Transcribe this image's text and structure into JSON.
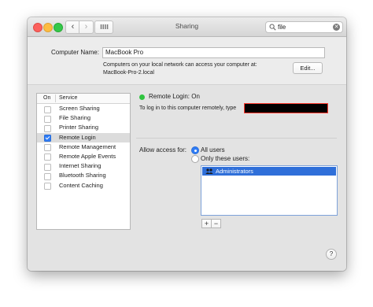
{
  "window": {
    "title": "Sharing",
    "search_value": "file"
  },
  "computer": {
    "label": "Computer Name:",
    "name_value": "MacBook Pro",
    "description_line1": "Computers on your local network can access your computer at:",
    "description_line2": "MacBook-Pro-2.local",
    "edit_label": "Edit..."
  },
  "services": {
    "col_on": "On",
    "col_service": "Service",
    "items": [
      {
        "label": "Screen Sharing",
        "checked": false
      },
      {
        "label": "File Sharing",
        "checked": false
      },
      {
        "label": "Printer Sharing",
        "checked": false
      },
      {
        "label": "Remote Login",
        "checked": true
      },
      {
        "label": "Remote Management",
        "checked": false
      },
      {
        "label": "Remote Apple Events",
        "checked": false
      },
      {
        "label": "Internet Sharing",
        "checked": false
      },
      {
        "label": "Bluetooth Sharing",
        "checked": false
      },
      {
        "label": "Content Caching",
        "checked": false
      }
    ]
  },
  "detail": {
    "status": "Remote Login: On",
    "login_instruction": "To log in to this computer remotely, type",
    "allow_access_label": "Allow access for:",
    "option_all": "All users",
    "option_only": "Only these users:",
    "users": [
      "Administrators"
    ]
  },
  "buttons": {
    "plus": "+",
    "minus": "−",
    "help": "?"
  },
  "colors": {
    "accent": "#2f7cf6",
    "status_on": "#2fc43f"
  }
}
